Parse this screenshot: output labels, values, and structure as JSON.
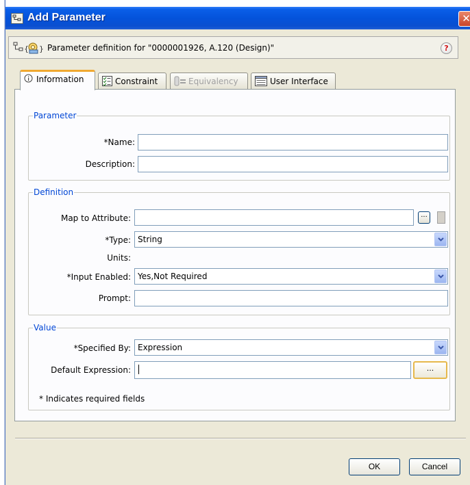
{
  "window": {
    "title": "Add Parameter",
    "close_glyph": "✕"
  },
  "header": {
    "text": "Parameter definition for \"0000001926, A.120 (Design)\"",
    "help_glyph": "?"
  },
  "tabs": [
    {
      "label": "Information",
      "icon": "info-icon",
      "state": "selected"
    },
    {
      "label": "Constraint",
      "icon": "checklist-icon",
      "state": "normal"
    },
    {
      "label": "Equivalency",
      "icon": "equivalency-icon",
      "state": "disabled"
    },
    {
      "label": "User Interface",
      "icon": "window-list-icon",
      "state": "normal"
    }
  ],
  "parameter_group": {
    "title": "Parameter",
    "name_label": "*Name:",
    "name_value": "",
    "description_label": "Description:",
    "description_value": ""
  },
  "definition_group": {
    "title": "Definition",
    "map_label": "Map to Attribute:",
    "map_value": "",
    "map_browse": "...",
    "type_label": "*Type:",
    "type_value": "String",
    "units_label": "Units:",
    "input_enabled_label": "*Input Enabled:",
    "input_enabled_value": "Yes,Not Required",
    "prompt_label": "Prompt:",
    "prompt_value": ""
  },
  "value_group": {
    "title": "Value",
    "specified_by_label": "*Specified By:",
    "specified_by_value": "Expression",
    "default_expr_label": "Default Expression:",
    "default_expr_value": "",
    "browse_label": "...",
    "required_note": "* Indicates required fields"
  },
  "footer": {
    "ok_label": "OK",
    "cancel_label": "Cancel"
  },
  "colors": {
    "title_bar": "#0453db",
    "dialog_bg": "#ece9d8",
    "group_title": "#0046d5",
    "focus_border": "#e6b84a"
  }
}
